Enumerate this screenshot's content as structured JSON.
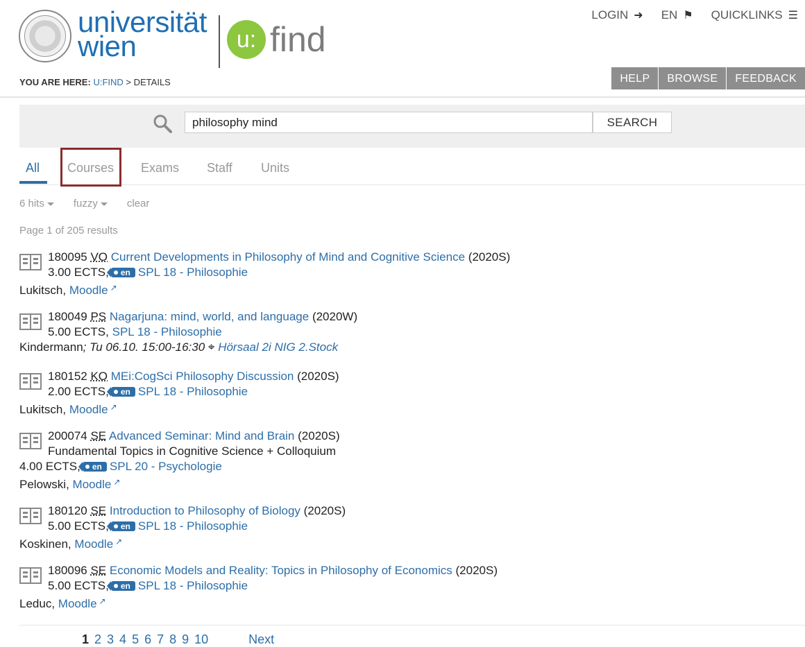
{
  "header": {
    "logo_line1": "universität",
    "logo_line2": "wien",
    "ufind_circle": "u:",
    "ufind_word": "find",
    "topnav": {
      "login": "LOGIN",
      "language": "EN",
      "quicklinks": "QUICKLINKS"
    },
    "breadcrumb": {
      "prefix": "YOU ARE HERE:",
      "home": "U:FIND",
      "separator": ">",
      "current": "DETAILS"
    },
    "buttons": {
      "help": "HELP",
      "browse": "BROWSE",
      "feedback": "FEEDBACK"
    }
  },
  "search": {
    "value": "philosophy mind",
    "button": "SEARCH"
  },
  "tabs": [
    {
      "label": "All",
      "active": true
    },
    {
      "label": "Courses",
      "active": false
    },
    {
      "label": "Exams",
      "active": false
    },
    {
      "label": "Staff",
      "active": false
    },
    {
      "label": "Units",
      "active": false
    }
  ],
  "filters": {
    "hits": "6 hits",
    "fuzzy": "fuzzy",
    "clear": "clear"
  },
  "page_info": "Page 1 of 205 results",
  "results": [
    {
      "code": "180095",
      "type": "VO",
      "title": "Current Developments in Philosophy of Mind and Cognitive Science",
      "semester": "(2020S)",
      "ects": "3.00 ECTS,",
      "lang": "en",
      "spl": "SPL 18 - Philosophie",
      "lecturer": "Lukitsch,",
      "extra": "Moodle"
    },
    {
      "code": "180049",
      "type": "PS",
      "title": "Nagarjuna: mind, world, and language",
      "semester": "(2020W)",
      "ects": "5.00 ECTS,",
      "spl": "SPL 18 - Philosophie",
      "lecturer": "Kindermann",
      "schedule": "; Tu 06.10. 15:00-16:30",
      "location": "Hörsaal 2i NIG 2.Stock"
    },
    {
      "code": "180152",
      "type": "KO",
      "title": "MEi:CogSci Philosophy Discussion",
      "semester": "(2020S)",
      "ects": "2.00 ECTS,",
      "lang": "en",
      "spl": "SPL 18 - Philosophie",
      "lecturer": "Lukitsch,",
      "extra": "Moodle"
    },
    {
      "code": "200074",
      "type": "SE",
      "title": "Advanced Seminar: Mind and Brain",
      "semester": "(2020S)",
      "subtitle": "Fundamental Topics in Cognitive Science + Colloquium",
      "ects": "4.00 ECTS,",
      "lang": "en",
      "spl": "SPL 20 - Psychologie",
      "lecturer": "Pelowski,",
      "extra": "Moodle"
    },
    {
      "code": "180120",
      "type": "SE",
      "title": "Introduction to Philosophy of Biology",
      "semester": "(2020S)",
      "ects": "5.00 ECTS,",
      "lang": "en",
      "spl": "SPL 18 - Philosophie",
      "lecturer": "Koskinen,",
      "extra": "Moodle"
    },
    {
      "code": "180096",
      "type": "SE",
      "title": "Economic Models and Reality: Topics in Philosophy of Economics",
      "semester": "(2020S)",
      "ects": "5.00 ECTS,",
      "lang": "en",
      "spl": "SPL 18 - Philosophie",
      "lecturer": "Leduc,",
      "extra": "Moodle"
    }
  ],
  "pagination": {
    "pages": [
      "1",
      "2",
      "3",
      "4",
      "5",
      "6",
      "7",
      "8",
      "9",
      "10"
    ],
    "next": "Next"
  }
}
